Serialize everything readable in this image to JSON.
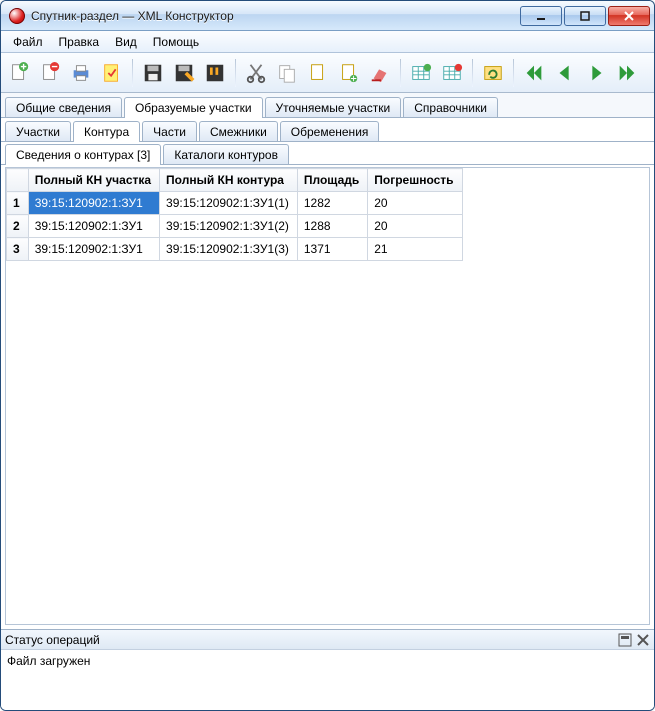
{
  "window": {
    "title": "Спутник-раздел — XML Конструктор"
  },
  "menu": {
    "file": "Файл",
    "edit": "Правка",
    "view": "Вид",
    "help": "Помощь"
  },
  "main_tabs": {
    "general": "Общие сведения",
    "formed": "Образуемые участки",
    "refined": "Уточняемые участки",
    "refs": "Справочники"
  },
  "sub_tabs": {
    "parcels": "Участки",
    "contours": "Контура",
    "parts": "Части",
    "neighbors": "Смежники",
    "encumb": "Обременения"
  },
  "sub_tabs2": {
    "contours_info": "Сведения о контурах [3]",
    "catalogs": "Каталоги контуров"
  },
  "table": {
    "headers": {
      "full_kn_parcel": "Полный КН участка",
      "full_kn_contour": "Полный КН контура",
      "area": "Площадь",
      "error": "Погрешность"
    },
    "rows": [
      {
        "n": "1",
        "kn_parcel": "39:15:120902:1:ЗУ1",
        "kn_contour": "39:15:120902:1:ЗУ1(1)",
        "area": "1282",
        "err": "20"
      },
      {
        "n": "2",
        "kn_parcel": "39:15:120902:1:ЗУ1",
        "kn_contour": "39:15:120902:1:ЗУ1(2)",
        "area": "1288",
        "err": "20"
      },
      {
        "n": "3",
        "kn_parcel": "39:15:120902:1:ЗУ1",
        "kn_contour": "39:15:120902:1:ЗУ1(3)",
        "area": "1371",
        "err": "21"
      }
    ]
  },
  "status": {
    "title": "Статус операций",
    "log": "Файл загружен"
  },
  "colors": {
    "accent": "#2f7bd1"
  }
}
